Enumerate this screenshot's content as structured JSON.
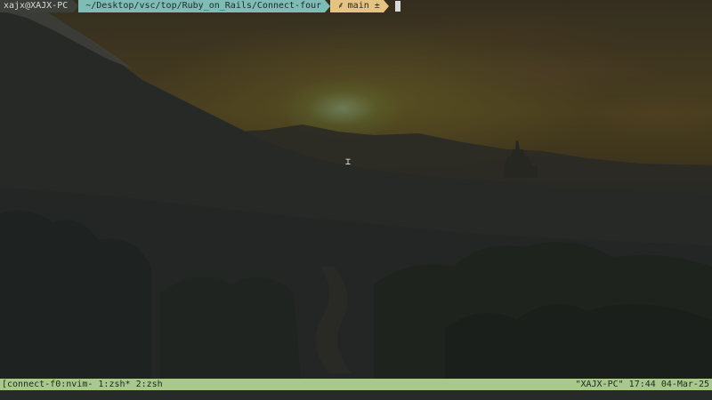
{
  "prompt": {
    "user_host": "xajx@XAJX-PC",
    "path": "~/Desktop/vsc/top/Ruby_on_Rails/Connect-four",
    "git_icon": "git-branch-icon",
    "branch": "main",
    "status_symbol": "±"
  },
  "statusbar": {
    "session": "[connect-f",
    "windows": [
      {
        "label": "0:nvim-"
      },
      {
        "label": "1:zsh*"
      },
      {
        "label": "2:zsh"
      }
    ],
    "host": "\"XAJX-PC\"",
    "time": "17:44",
    "date": "04-Mar-25"
  },
  "colors": {
    "prompt_user_bg": "#3b3f3a",
    "prompt_path_bg": "#7fbcb6",
    "prompt_git_bg": "#e4c383",
    "status_bg": "#a9c98b"
  }
}
